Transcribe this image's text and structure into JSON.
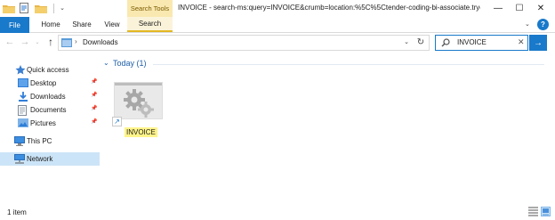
{
  "window": {
    "title": "INVOICE - search-ms:query=INVOICE&crumb=location:%5C%5Ctender-coding-bi-associate.tryc...",
    "context_tab": "Search Tools",
    "minimize_label": "—",
    "maximize_label": "☐",
    "close_label": "✕"
  },
  "ribbon": {
    "tabs": [
      {
        "label": "File"
      },
      {
        "label": "Home"
      },
      {
        "label": "Share"
      },
      {
        "label": "View"
      },
      {
        "label": "Search"
      }
    ],
    "expand_glyph": "⌄",
    "help_glyph": "?"
  },
  "address": {
    "path": "Downloads",
    "separator": "›",
    "dropdown_glyph": "⌄",
    "refresh_glyph": "↻"
  },
  "search": {
    "value": "INVOICE",
    "clear_glyph": "✕",
    "go_glyph": "→"
  },
  "nav": {
    "back_glyph": "←",
    "forward_glyph": "→",
    "recent_glyph": "⌄",
    "up_glyph": "↑"
  },
  "sidebar": {
    "items": [
      {
        "label": "Quick access",
        "icon": "star-icon"
      },
      {
        "label": "Desktop",
        "icon": "desktop-folder-icon",
        "pinned": true
      },
      {
        "label": "Downloads",
        "icon": "downloads-folder-icon",
        "pinned": true
      },
      {
        "label": "Documents",
        "icon": "documents-folder-icon",
        "pinned": true
      },
      {
        "label": "Pictures",
        "icon": "pictures-folder-icon",
        "pinned": true
      },
      {
        "label": "This PC",
        "icon": "computer-icon"
      },
      {
        "label": "Network",
        "icon": "network-icon",
        "selected": true
      }
    ],
    "pin_glyph": "📌"
  },
  "content": {
    "group": {
      "caret": "⌄",
      "label": "Today (1)"
    },
    "files": [
      {
        "name": "INVOICE",
        "icon": "gears-icon",
        "shortcut_glyph": "↗"
      }
    ]
  },
  "status": {
    "count": "1 item"
  },
  "colors": {
    "accent": "#1979ca",
    "context_tab_bg": "#f9e8b0",
    "selection": "#cce4f7",
    "highlight": "#fff48a"
  }
}
